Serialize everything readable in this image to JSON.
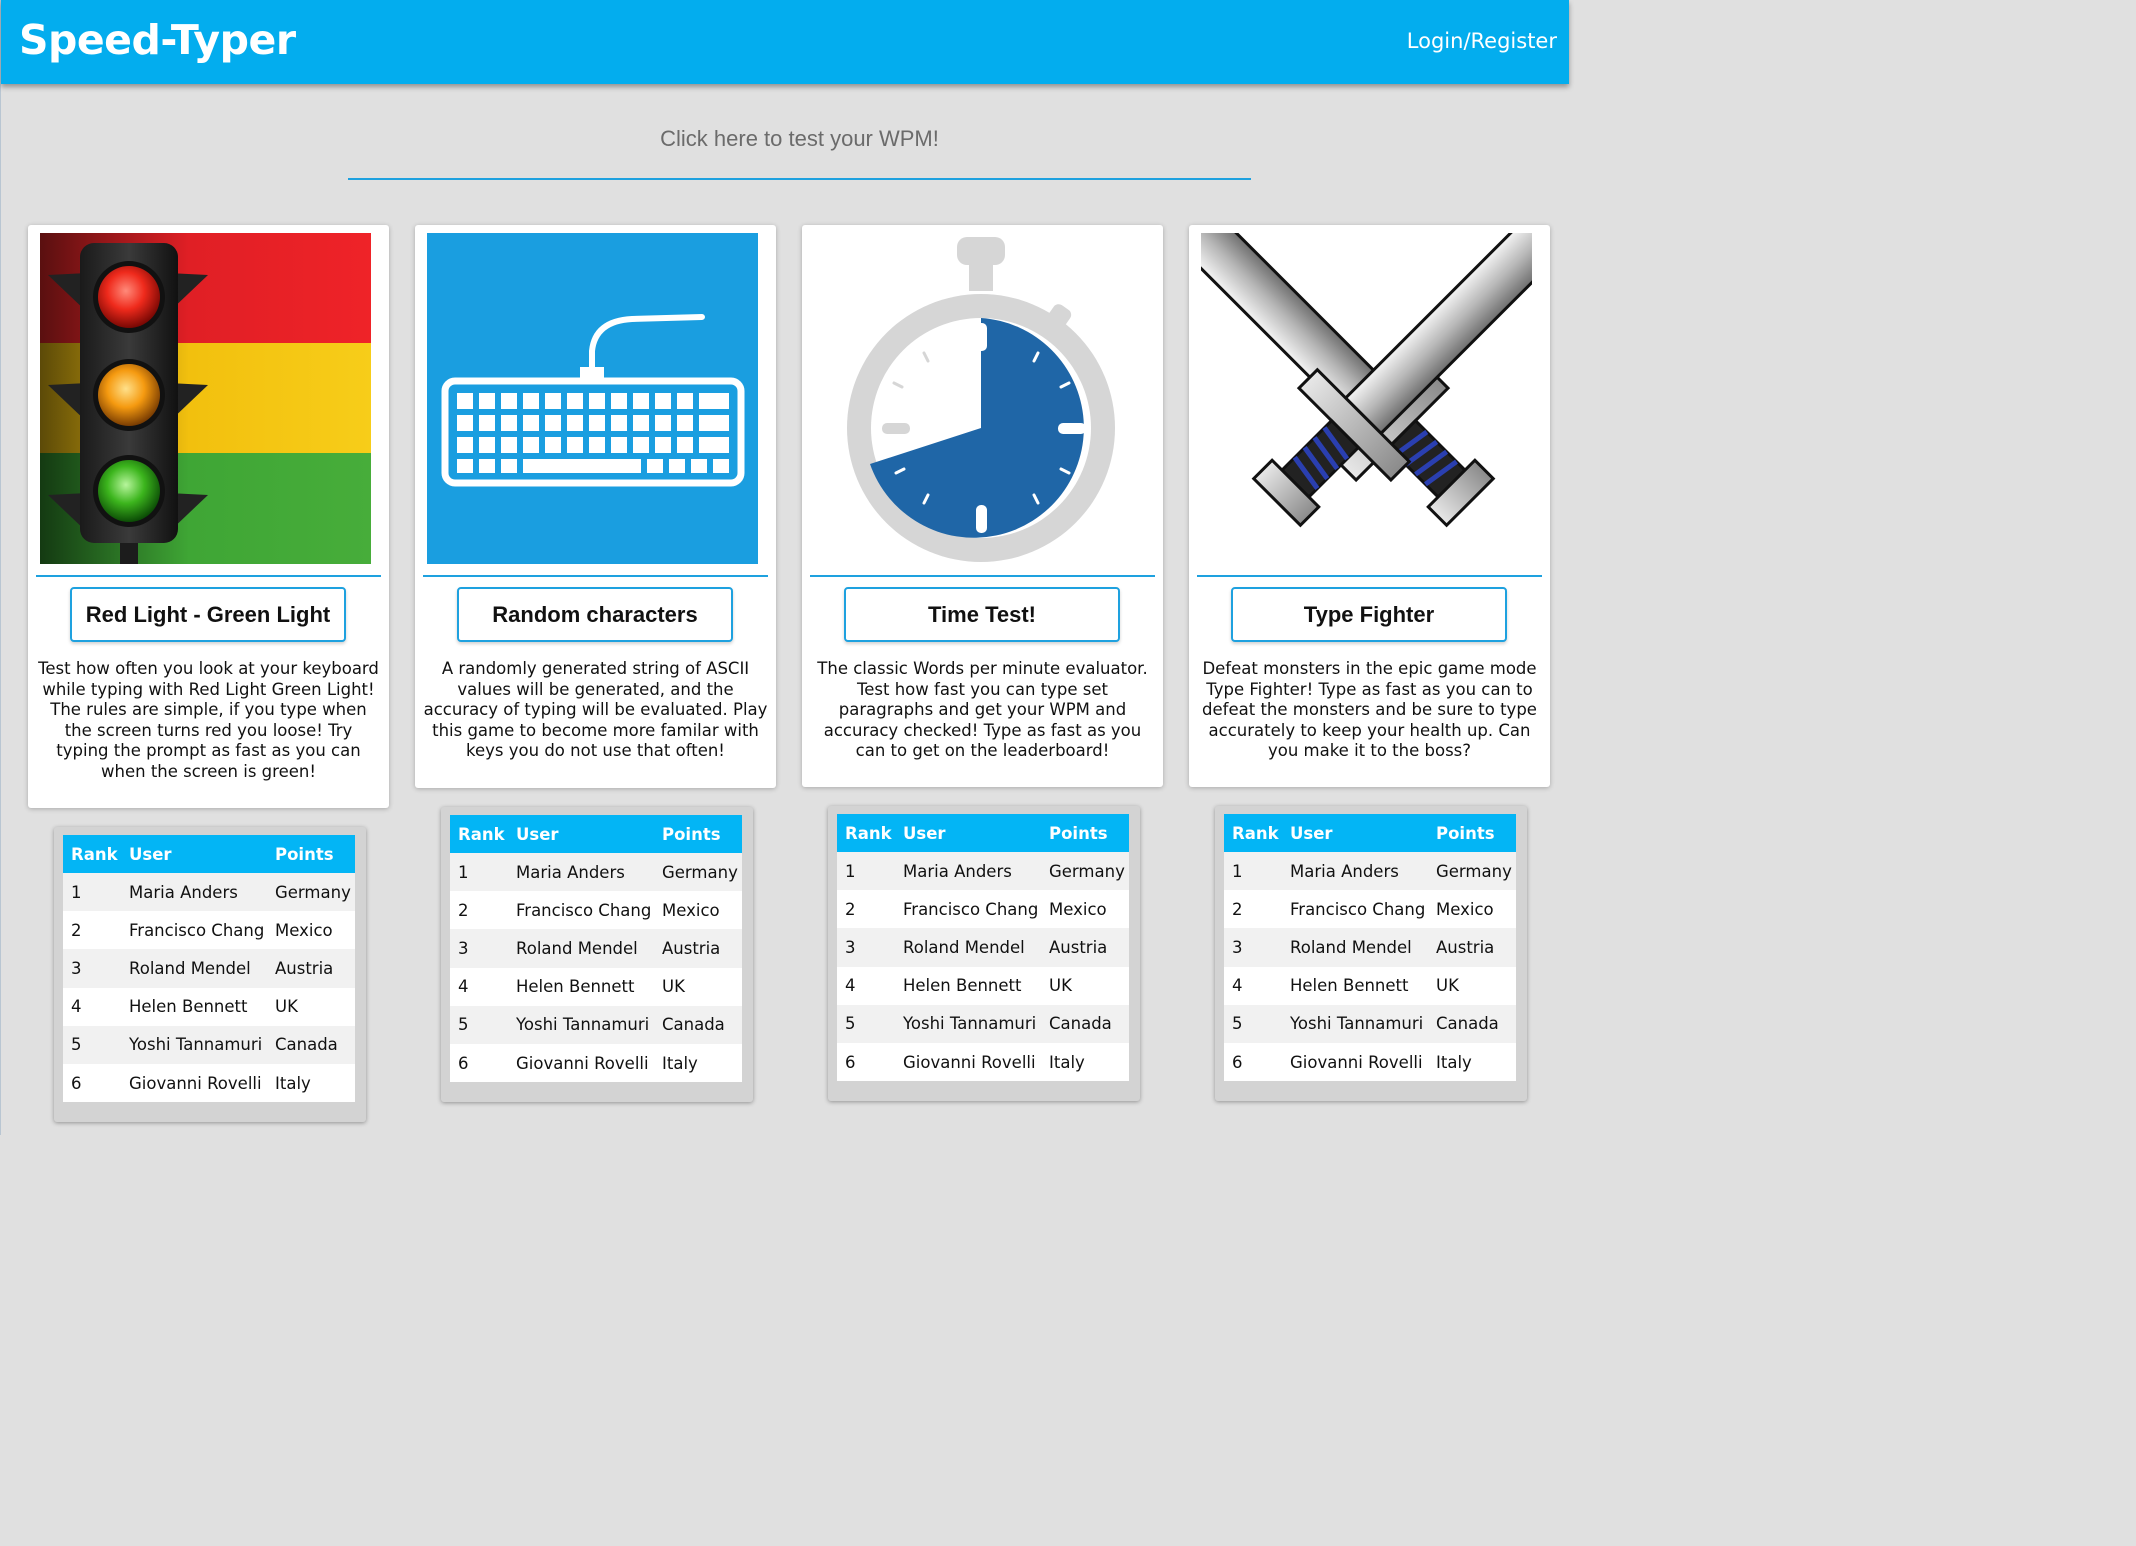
{
  "header": {
    "brand": "Speed-Typer",
    "login_label": "Login/Register",
    "bg_color": "#03adee"
  },
  "wpm_prompt": "Click here to test your WPM!",
  "games": [
    {
      "title": "Red Light - Green Light",
      "image": "traffic-light-icon",
      "description": "Test how often you look at your keyboard while typing with Red Light Green Light! The rules are simple, if you type when the screen turns red you loose! Try typing the prompt as fast as you can when the screen is green!"
    },
    {
      "title": "Random characters",
      "image": "keyboard-icon",
      "description": "A randomly generated string of ASCII values will be generated, and the accuracy of typing will be evaluated. Play this game to become more familar with keys you do not use that often!"
    },
    {
      "title": "Time Test!",
      "image": "stopwatch-icon",
      "description": "The classic Words per minute evaluator. Test how fast you can type set paragraphs and get your WPM and accuracy checked! Type as fast as you can to get on the leaderboard!"
    },
    {
      "title": "Type Fighter",
      "image": "crossed-swords-icon",
      "description": "Defeat monsters in the epic game mode Type Fighter! Type as fast as you can to defeat the monsters and be sure to type accurately to keep your health up. Can you make it to the boss?"
    }
  ],
  "leaderboard": {
    "headers": [
      "Rank",
      "User",
      "Points"
    ],
    "rows": [
      [
        "1",
        "Maria Anders",
        "Germany"
      ],
      [
        "2",
        "Francisco Chang",
        "Mexico"
      ],
      [
        "3",
        "Roland Mendel",
        "Austria"
      ],
      [
        "4",
        "Helen Bennett",
        "UK"
      ],
      [
        "5",
        "Yoshi Tannamuri",
        "Canada"
      ],
      [
        "6",
        "Giovanni Rovelli",
        "Italy"
      ]
    ],
    "header_color": "#03b5f5"
  },
  "accent_color": "#1ea1df"
}
